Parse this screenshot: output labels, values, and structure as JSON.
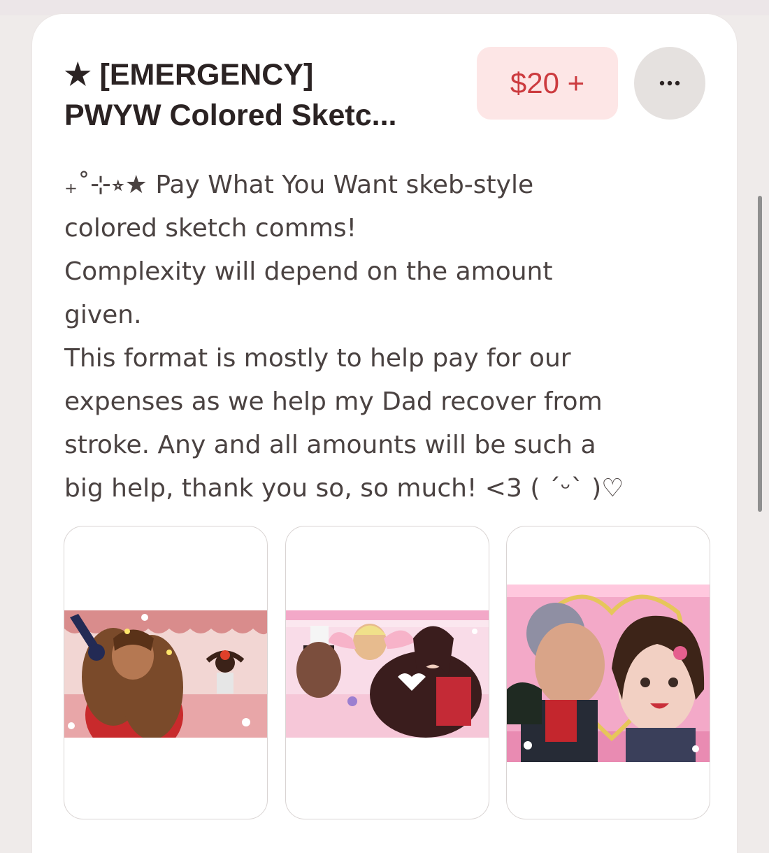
{
  "listing": {
    "title_line1": "★ [EMERGENCY]",
    "title_line2": "PWYW Colored Sketc...",
    "price": "$20 +",
    "more_icon": "ellipsis-icon",
    "description_lines": [
      "₊˚⊹⭒★ Pay What You Want skeb-style",
      "colored sketch comms!",
      "Complexity will depend on the amount",
      "given.",
      "This format is mostly to help pay for our",
      "expenses as we help my Dad recover from",
      "stroke. Any and all amounts will be such a",
      "big help, thank you so, so much! <3 ( ˊᵕˋ )♡"
    ]
  },
  "colors": {
    "price_bg": "#fde6e6",
    "price_text": "#cc3b3f",
    "more_bg": "#e5e1df",
    "title_text": "#2b2323",
    "body_text": "#4a4241"
  },
  "gallery": [
    {
      "name": "sample-artwork-1"
    },
    {
      "name": "sample-artwork-2"
    },
    {
      "name": "sample-artwork-3"
    }
  ]
}
